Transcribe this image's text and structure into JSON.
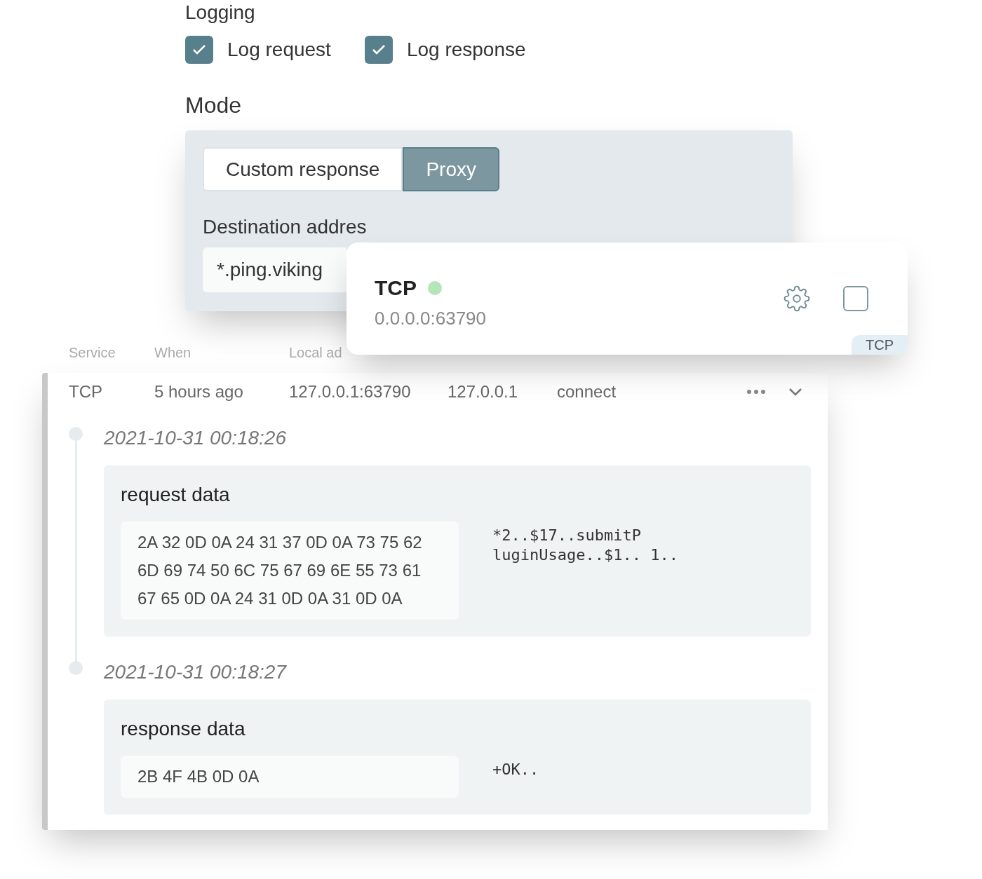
{
  "logging": {
    "title": "Logging",
    "options": [
      {
        "label": "Log request",
        "checked": true
      },
      {
        "label": "Log response",
        "checked": true
      }
    ]
  },
  "mode": {
    "title": "Mode",
    "options": [
      {
        "label": "Custom response",
        "selected": false
      },
      {
        "label": "Proxy",
        "selected": true
      }
    ],
    "destination_label": "Destination addres",
    "destination_value": "*.ping.viking"
  },
  "service_card": {
    "name": "TCP",
    "online": true,
    "address": "0.0.0.0:63790",
    "tag": "TCP"
  },
  "table": {
    "columns": [
      "Service",
      "When",
      "Local ad"
    ],
    "row": {
      "service": "TCP",
      "when": "5 hours ago",
      "local_address": "127.0.0.1:63790",
      "client_ip": "127.0.0.1",
      "description": "connect",
      "expanded": true
    },
    "events": [
      {
        "time": "2021-10-31 00:18:26",
        "title": "request data",
        "hex": [
          "2A 32 0D 0A 24 31 37 0D 0A 73 75 62",
          "6D 69 74 50 6C 75 67 69 6E 55 73 61",
          "67 65 0D 0A 24 31 0D 0A 31 0D 0A"
        ],
        "ascii": [
          "*2..$17..submitP",
          "luginUsage..$1.. 1.."
        ]
      },
      {
        "time": "2021-10-31 00:18:27",
        "title": "response data",
        "hex": [
          "2B 4F 4B 0D 0A"
        ],
        "ascii": [
          "+OK.."
        ]
      }
    ]
  }
}
